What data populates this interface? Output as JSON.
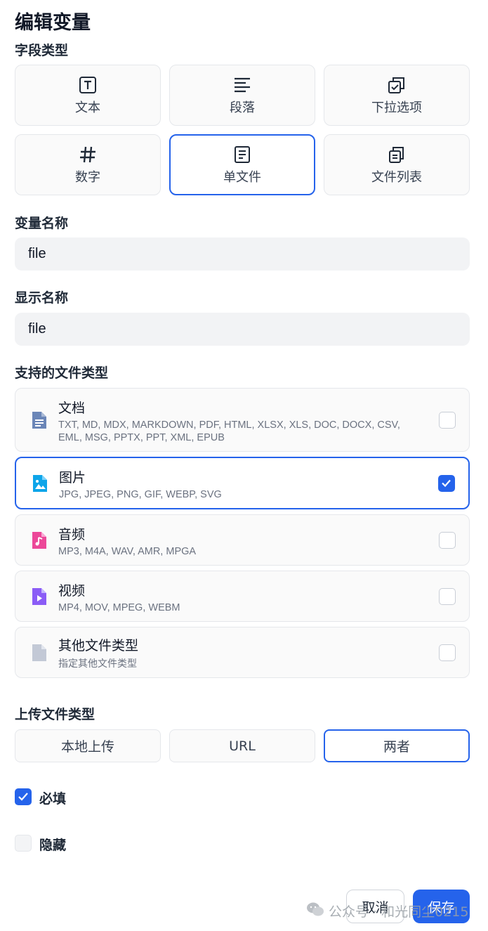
{
  "dialog": {
    "title": "编辑变量"
  },
  "field_type": {
    "label": "字段类型",
    "options": [
      {
        "label": "文本",
        "icon": "text-box-icon",
        "selected": false
      },
      {
        "label": "段落",
        "icon": "paragraph-icon",
        "selected": false
      },
      {
        "label": "下拉选项",
        "icon": "select-options-icon",
        "selected": false
      },
      {
        "label": "数字",
        "icon": "hash-icon",
        "selected": false
      },
      {
        "label": "单文件",
        "icon": "single-file-icon",
        "selected": true
      },
      {
        "label": "文件列表",
        "icon": "file-list-icon",
        "selected": false
      }
    ]
  },
  "variable_name": {
    "label": "变量名称",
    "value": "file"
  },
  "display_name": {
    "label": "显示名称",
    "value": "file"
  },
  "supported_types": {
    "label": "支持的文件类型",
    "items": [
      {
        "title": "文档",
        "desc": "TXT, MD, MDX, MARKDOWN, PDF, HTML, XLSX, XLS, DOC, DOCX, CSV, EML, MSG, PPTX, PPT, XML, EPUB",
        "icon": "document-icon",
        "color": "#6b86b8",
        "checked": false
      },
      {
        "title": "图片",
        "desc": "JPG, JPEG, PNG, GIF, WEBP, SVG",
        "icon": "image-icon",
        "color": "#0ea5e9",
        "checked": true
      },
      {
        "title": "音频",
        "desc": "MP3, M4A, WAV, AMR, MPGA",
        "icon": "audio-icon",
        "color": "#ec4899",
        "checked": false
      },
      {
        "title": "视频",
        "desc": "MP4, MOV, MPEG, WEBM",
        "icon": "video-icon",
        "color": "#8b5cf6",
        "checked": false
      },
      {
        "title": "其他文件类型",
        "desc": "指定其他文件类型",
        "icon": "other-file-icon",
        "color": "#c3c9d6",
        "checked": false
      }
    ]
  },
  "upload_type": {
    "label": "上传文件类型",
    "options": [
      {
        "label": "本地上传",
        "selected": false
      },
      {
        "label": "URL",
        "selected": false
      },
      {
        "label": "两者",
        "selected": true
      }
    ]
  },
  "required": {
    "label": "必填",
    "checked": true
  },
  "hidden": {
    "label": "隐藏",
    "checked": false
  },
  "actions": {
    "cancel": "取消",
    "save": "保存"
  },
  "watermark": {
    "text": "公众号 · 和光同尘0215"
  },
  "colors": {
    "accent": "#2563eb",
    "input_bg": "#f2f3f5",
    "card_bg": "#fafafa"
  }
}
